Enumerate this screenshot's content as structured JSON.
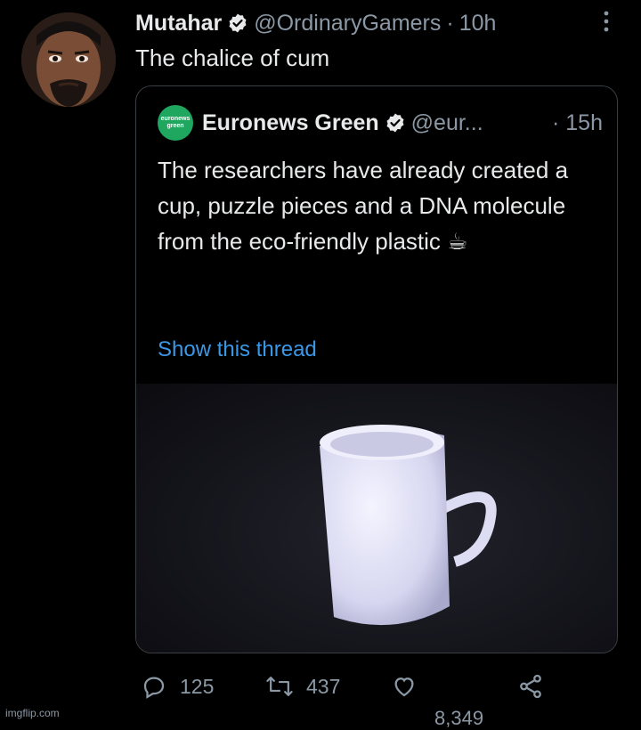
{
  "tweet": {
    "author_name": "Mutahar",
    "handle": "@OrdinaryGamers",
    "separator": "·",
    "time": "10h",
    "text": "The chalice of cum"
  },
  "quoted_tweet": {
    "logo_text_line1": "euronews",
    "logo_text_line2": "green",
    "author_name": "Euronews Green",
    "handle": "@eur...",
    "separator": "·",
    "time": "15h",
    "text": "The researchers have already created a cup, puzzle pieces and a DNA molecule from the eco-friendly plastic ☕",
    "ellipsis": "...",
    "show_thread": "Show this thread"
  },
  "actions": {
    "replies": "125",
    "retweets": "437",
    "likes": "8,349"
  },
  "watermark": "imgflip.com",
  "colors": {
    "background": "#000000",
    "text": "#e7e9ea",
    "secondary": "#8b98a5",
    "link": "#3b98e6",
    "verified": "#e7e9ea",
    "euronews_green": "#1fa760"
  }
}
